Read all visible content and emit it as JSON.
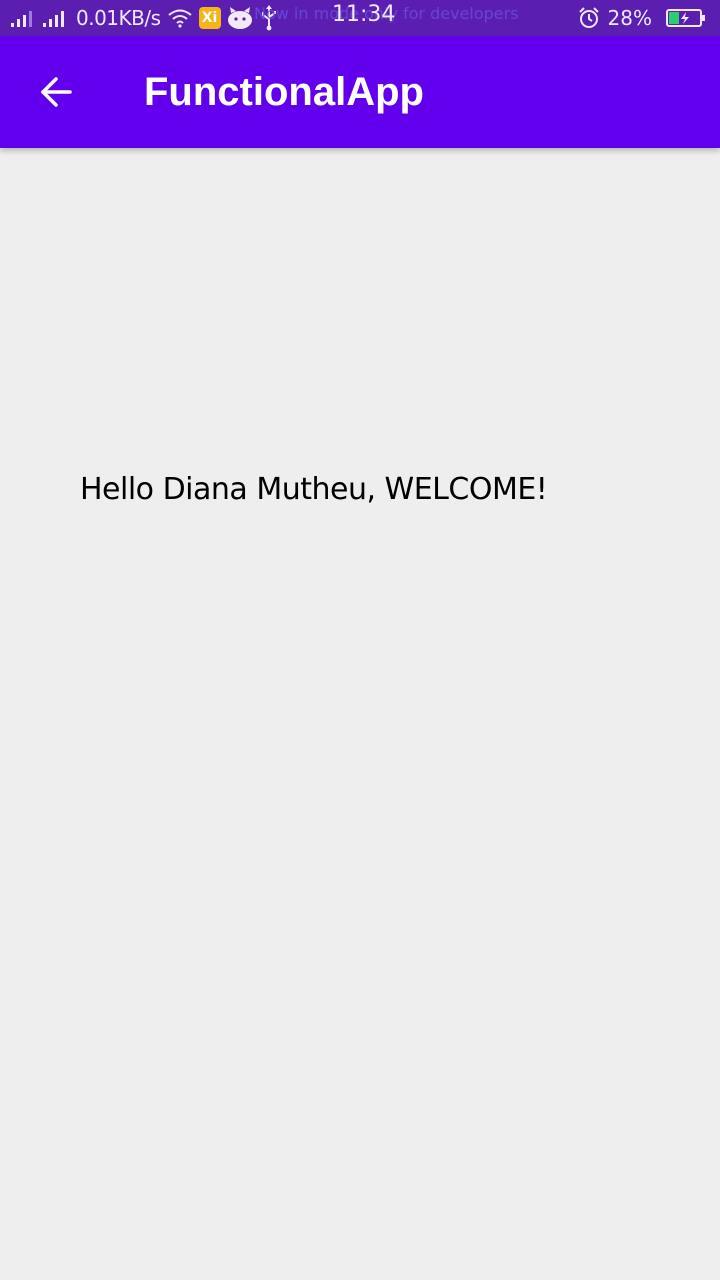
{
  "status_bar": {
    "network_speed": "0.01KB/s",
    "developer_notice": "Now in mode only for developers",
    "time": "11:34",
    "battery_percent": "28%",
    "icons": [
      "signal-icon",
      "signal-icon",
      "wifi-icon",
      "mi-badge-icon",
      "android-bot-icon",
      "usb-icon",
      "alarm-icon",
      "battery-icon"
    ],
    "mi_badge_text": "Xi",
    "battery_level": 0.28,
    "battery_color": "#2ecc71",
    "background_color": "#5a1fb0"
  },
  "app_bar": {
    "title": "FunctionalApp",
    "back_icon": "arrow-left-icon",
    "background_color": "#6200ee"
  },
  "main": {
    "welcome_message": "Hello Diana Mutheu, WELCOME!",
    "background_color": "#eeeeee"
  }
}
